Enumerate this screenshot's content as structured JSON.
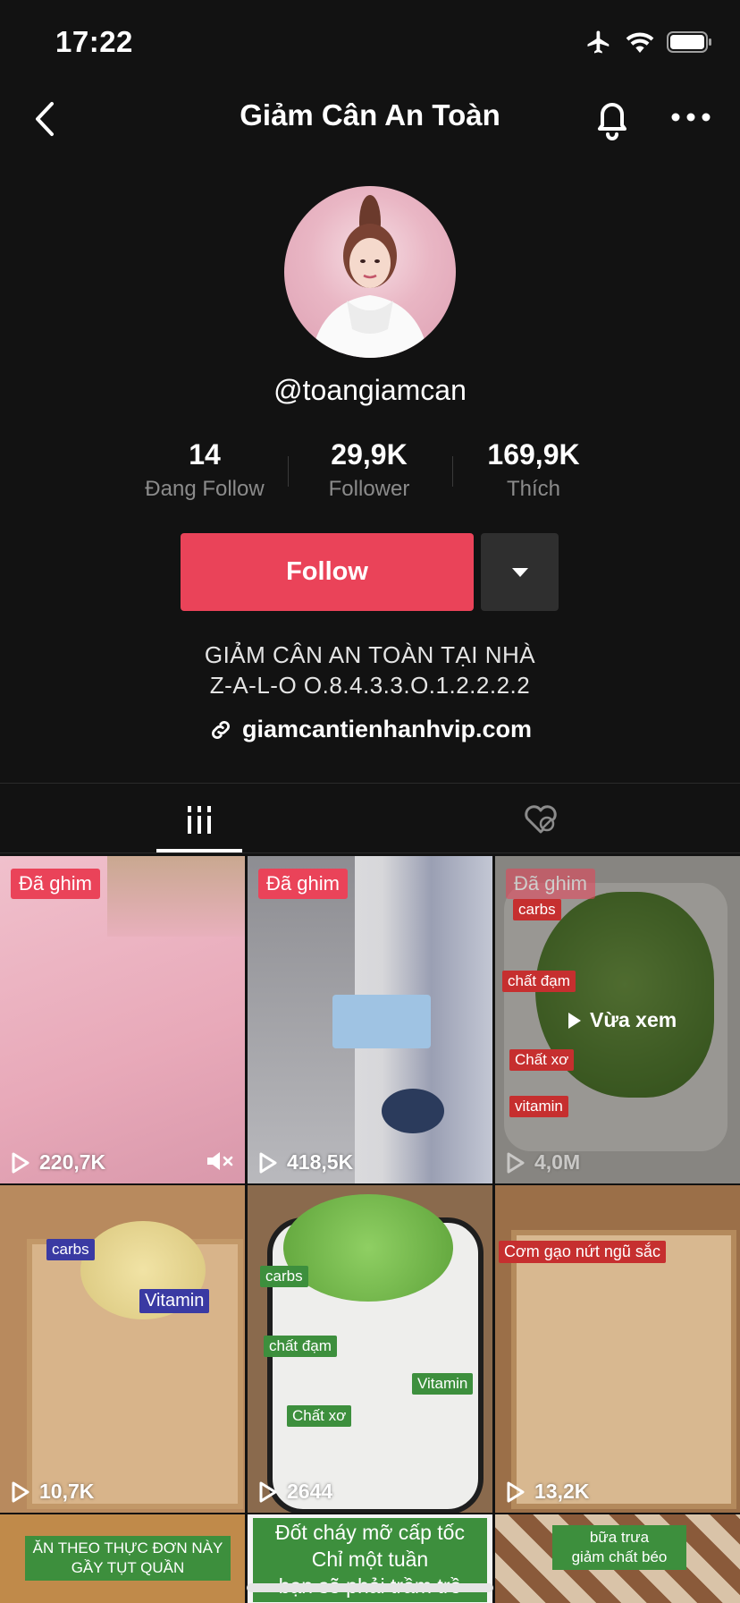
{
  "status_bar": {
    "time": "17:22"
  },
  "nav": {
    "title": "Giảm Cân An Toàn"
  },
  "profile": {
    "handle": "@toangiamcan",
    "stats": [
      {
        "value": "14",
        "label": "Đang Follow"
      },
      {
        "value": "29,9K",
        "label": "Follower"
      },
      {
        "value": "169,9K",
        "label": "Thích"
      }
    ],
    "follow_label": "Follow",
    "bio_line1": "GIẢM CÂN AN TOÀN TẠI NHÀ",
    "bio_line2": "Z-A-L-O  O.8.4.3.3.O.1.2.2.2.2",
    "link": "giamcantienhanhvip.com"
  },
  "colors": {
    "accent": "#ea4359",
    "background": "#121212"
  },
  "videos": [
    {
      "pinned": "Đã ghim",
      "views": "220,7K",
      "muted_icon": "mute-icon"
    },
    {
      "pinned": "Đã ghim",
      "views": "418,5K"
    },
    {
      "pinned": "Đã ghim",
      "views": "4,0M",
      "watched": "Vừa xem",
      "tags": [
        "carbs",
        "chất đạm",
        "Chất xơ",
        "vitamin"
      ]
    },
    {
      "views": "10,7K",
      "tags": [
        "carbs",
        "Vitamin"
      ]
    },
    {
      "views": "2644",
      "tags": [
        "carbs",
        "chất đạm",
        "Chất xơ",
        "Vitamin"
      ]
    },
    {
      "views": "13,2K",
      "tags": [
        "Cơm gạo nứt ngũ sắc"
      ]
    },
    {
      "caption1": "ĂN THEO THỰC ĐƠN NÀY",
      "caption2": "GẦY TỤT QUẦN"
    },
    {
      "caption1": "Đốt cháy mỡ cấp tốc",
      "caption2": "Chỉ một tuần",
      "caption3": "bạn sẽ phải trầm trồ"
    },
    {
      "caption1": "bữa trưa",
      "caption2": "giảm chất béo"
    }
  ]
}
